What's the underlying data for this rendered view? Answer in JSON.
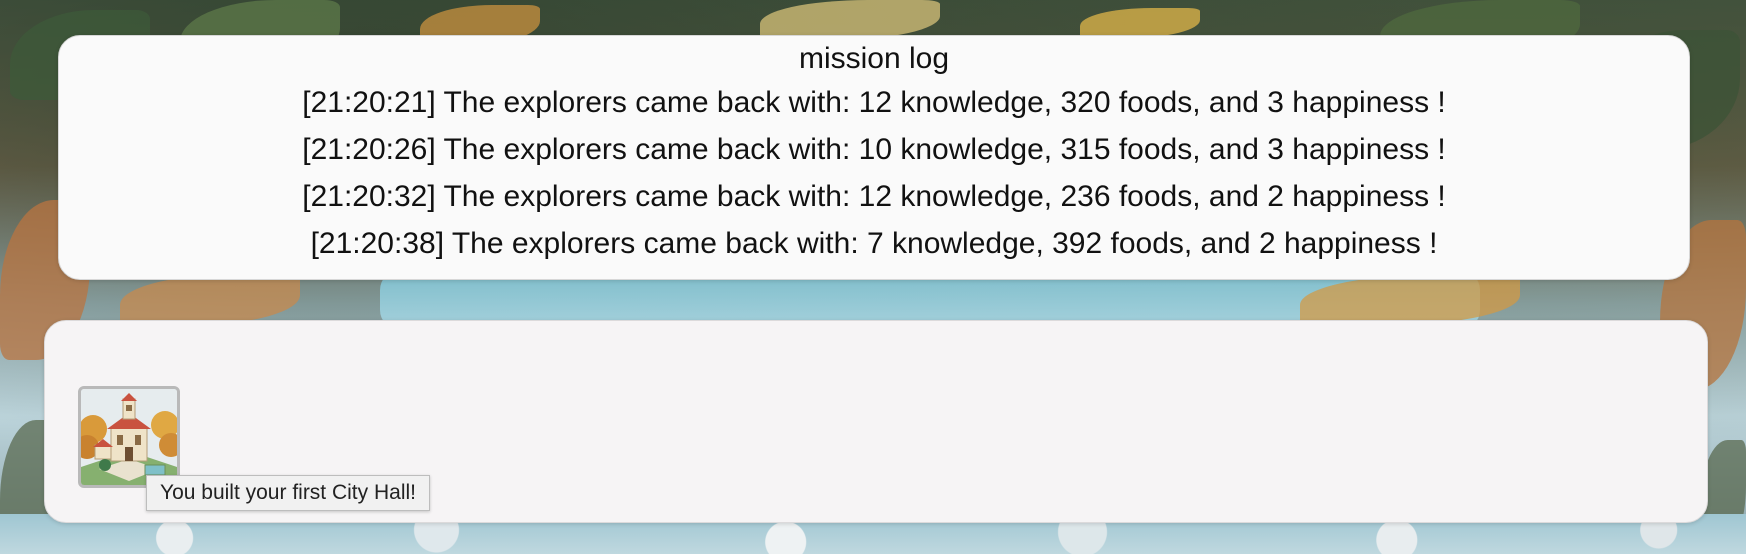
{
  "mission_log": {
    "title": "mission log",
    "entries": [
      "[21:20:21] The explorers came back with: 12 knowledge, 320 foods, and 3 happiness !",
      "[21:20:26] The explorers came back with: 10 knowledge, 315 foods, and 3 happiness !",
      "[21:20:32] The explorers came back with: 12 knowledge, 236 foods, and 2 happiness !",
      "[21:20:38] The explorers came back with: 7 knowledge, 392 foods, and 2 happiness !"
    ]
  },
  "achievements": {
    "items": [
      {
        "icon": "city-hall-icon",
        "tooltip": "You built your first City Hall!"
      }
    ]
  }
}
